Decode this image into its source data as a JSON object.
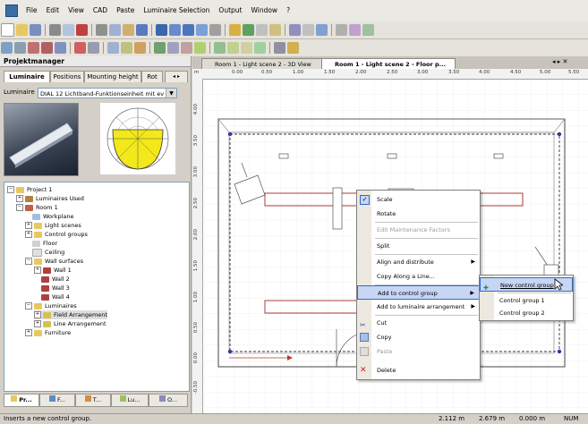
{
  "menu": {
    "items": [
      "File",
      "Edit",
      "View",
      "CAD",
      "Paste",
      "Luminaire Selection",
      "Output",
      "Window",
      "?"
    ]
  },
  "panel": {
    "title": "Projektmanager",
    "tabs": [
      "Luminaire",
      "Positions",
      "Mounting height",
      "Rot"
    ],
    "luminaire_label": "Luminaire",
    "luminaire_value": "DIAL 12 Lichtband-Funktionseinheit mit ev"
  },
  "tree": {
    "items": [
      {
        "label": "Project 1",
        "indent": 0,
        "icon": "folder-icon"
      },
      {
        "label": "Luminaires Used",
        "indent": 1,
        "icon": "luminaire-icon"
      },
      {
        "label": "Room 1",
        "indent": 1,
        "icon": "room-icon"
      },
      {
        "label": "Workplane",
        "indent": 2,
        "icon": "plane-icon"
      },
      {
        "label": "Light scenes",
        "indent": 2,
        "icon": "folder-icon"
      },
      {
        "label": "Control groups",
        "indent": 2,
        "icon": "folder-icon"
      },
      {
        "label": "Floor",
        "indent": 2,
        "icon": "floor-icon"
      },
      {
        "label": "Ceiling",
        "indent": 2,
        "icon": "ceiling-icon"
      },
      {
        "label": "Wall surfaces",
        "indent": 2,
        "icon": "folder-icon"
      },
      {
        "label": "Wall 1",
        "indent": 3,
        "icon": "wall-icon"
      },
      {
        "label": "Wall 2",
        "indent": 3,
        "icon": "wall-icon"
      },
      {
        "label": "Wall 3",
        "indent": 3,
        "icon": "wall-icon"
      },
      {
        "label": "Wall 4",
        "indent": 3,
        "icon": "wall-icon"
      },
      {
        "label": "Luminaires",
        "indent": 2,
        "icon": "folder-icon"
      },
      {
        "label": "Field Arrangement",
        "indent": 3,
        "icon": "arrangement-icon"
      },
      {
        "label": "Line Arrangement",
        "indent": 3,
        "icon": "arrangement-icon"
      },
      {
        "label": "Furniture",
        "indent": 2,
        "icon": "folder-icon"
      }
    ]
  },
  "bottom_tabs": [
    "Pr...",
    "F...",
    "T...",
    "Lu...",
    "O..."
  ],
  "doc_tabs": [
    "Room 1 - Light scene 2 - 3D View",
    "Room 1 - Light scene 2 - Floor p..."
  ],
  "ruler": {
    "h_labels": [
      "0.00",
      "0.50",
      "1.00",
      "1.50",
      "2.00",
      "2.50",
      "3.00",
      "3.50",
      "4.00",
      "4.50",
      "5.00",
      "5.50"
    ],
    "h_unit": "m",
    "v_labels": [
      "4.00",
      "3.50",
      "3.00",
      "2.50",
      "2.00",
      "1.50",
      "1.00",
      "0.50",
      "0.00",
      "-0.50"
    ]
  },
  "context_menu": {
    "items": [
      {
        "label": "Scale",
        "checked": true
      },
      {
        "label": "Rotate"
      },
      {
        "label": "Edit Maintenance Factors",
        "disabled": true
      },
      {
        "label": "Split"
      },
      {
        "label": "Align and distribute",
        "submenu": true
      },
      {
        "label": "Copy Along a Line..."
      },
      {
        "label": "Add to control group",
        "submenu": true,
        "highlighted": true
      },
      {
        "label": "Add to luminaire arrangement",
        "submenu": true
      },
      {
        "label": "Cut",
        "icon": "scissors-icon"
      },
      {
        "label": "Copy",
        "icon": "copy-icon"
      },
      {
        "label": "Paste",
        "icon": "paste-icon",
        "disabled": true
      },
      {
        "label": "Delete",
        "icon": "delete-icon"
      }
    ]
  },
  "submenu": {
    "items": [
      "New control group",
      "Control group 1",
      "Control group 2"
    ],
    "highlighted": 0
  },
  "status": {
    "message": "Inserts a new control group.",
    "x": "2.112 m",
    "y": "2.679 m",
    "z": "0.000 m",
    "mode": "NUM"
  },
  "colors": {
    "accent": "#316ac5",
    "highlight": "#c6d6f3",
    "luminaire_red": "#b03a3a"
  }
}
